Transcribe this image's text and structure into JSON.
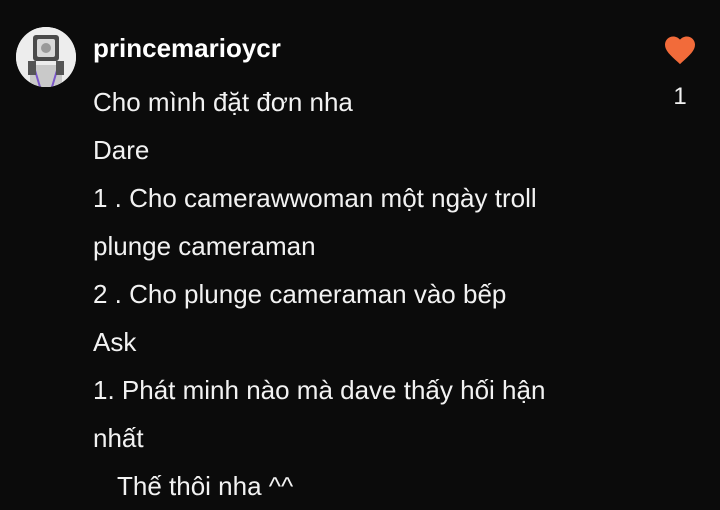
{
  "comment": {
    "username": "princemarioycr",
    "lines": [
      "Cho mình đặt đơn nha",
      "Dare",
      "1 . Cho camerawwoman một ngày troll",
      "plunge cameraman",
      "2 . Cho plunge cameraman vào bếp",
      "Ask",
      "1. Phát minh nào mà dave thấy hối hận",
      "nhất",
      "Thế thôi nha ^^"
    ]
  },
  "like": {
    "icon": "heart-icon",
    "count": "1",
    "color": "#f26b3a"
  },
  "colors": {
    "background": "#0b0b0b",
    "text": "#f2f2f2"
  }
}
